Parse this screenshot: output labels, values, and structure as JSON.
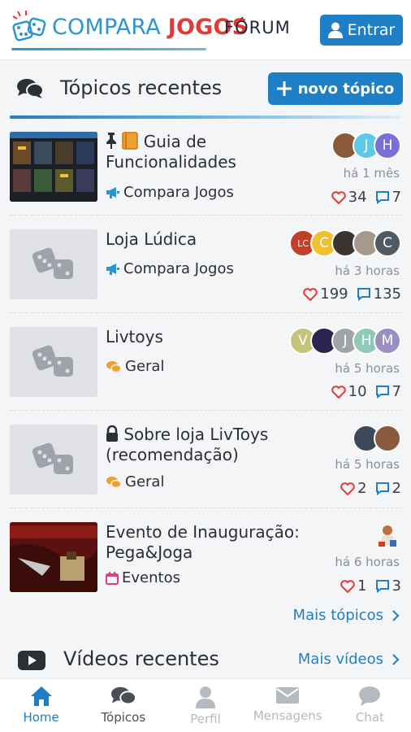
{
  "header": {
    "logo_part1": "COMPARA",
    "logo_part2": "JOGOS",
    "forum_label": "FÓRUM",
    "login_label": "Entrar"
  },
  "recent_topics": {
    "title": "Tópicos recentes",
    "new_topic_label": "novo tópico",
    "more_label": "Mais tópicos",
    "items": [
      {
        "title": "Guia de Funcionalidades",
        "category": "Compara Jogos",
        "time": "há 1 mês",
        "likes": "34",
        "replies": "7",
        "avatars": [
          "J",
          "H"
        ]
      },
      {
        "title": "Loja Lúdica",
        "category": "Compara Jogos",
        "time": "há 3 horas",
        "likes": "199",
        "replies": "135",
        "avatars": [
          "LC",
          "C",
          "C"
        ]
      },
      {
        "title": "Livtoys",
        "category": "Geral",
        "time": "há 5 horas",
        "likes": "10",
        "replies": "7",
        "avatars": [
          "V",
          "J",
          "H",
          "M"
        ]
      },
      {
        "title": "Sobre loja LivToys (recomendação)",
        "category": "Geral",
        "time": "há 5 horas",
        "likes": "2",
        "replies": "2",
        "avatars": []
      },
      {
        "title": "Evento de Inauguração: Pega&Joga",
        "category": "Eventos",
        "time": "há 6 horas",
        "likes": "1",
        "replies": "3",
        "avatars": []
      }
    ]
  },
  "recent_videos": {
    "title": "Vídeos recentes",
    "more_label": "Mais vídeos"
  },
  "bottom_nav": {
    "home": "Home",
    "topics": "Tópicos",
    "profile": "Perfil",
    "messages": "Mensagens",
    "chat": "Chat"
  },
  "colors": {
    "accent": "#1e7fc7",
    "logo_blue": "#2e95d3",
    "logo_red": "#e53935",
    "like_red": "#e53935"
  }
}
